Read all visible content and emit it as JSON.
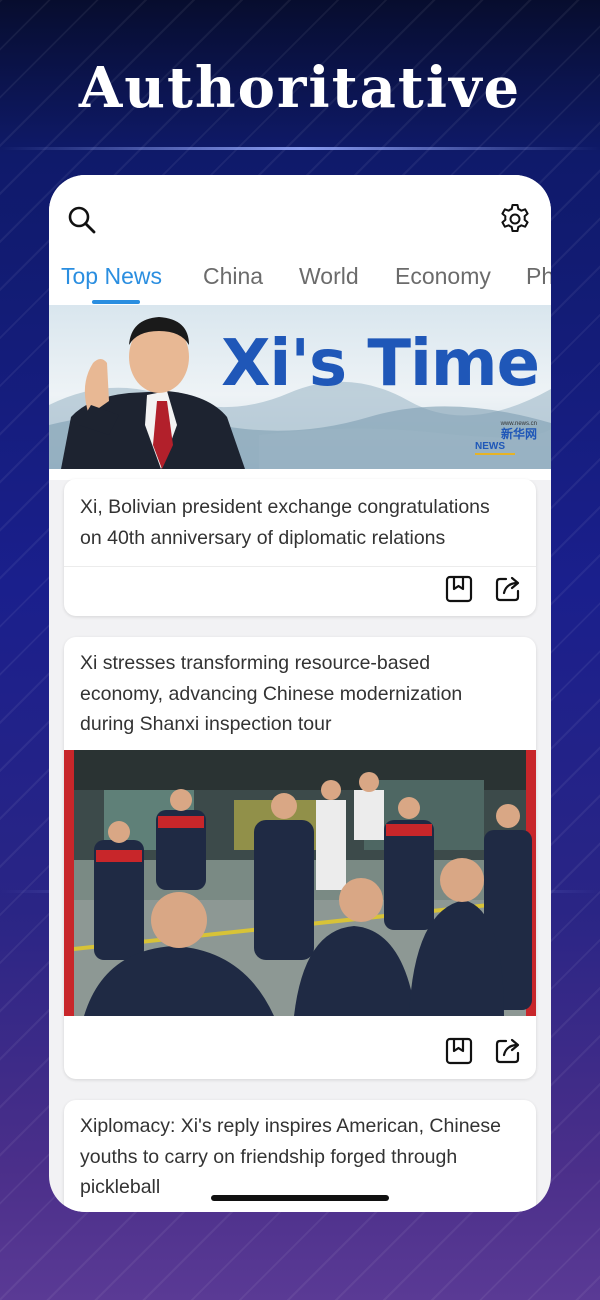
{
  "promo": {
    "headline": "Authoritative"
  },
  "app": {
    "icons": {
      "search": "search-icon",
      "settings": "gear-icon",
      "bookmark": "bookmark-icon",
      "share": "share-icon"
    },
    "colors": {
      "accent": "#2a8ee0",
      "text": "#333333",
      "tab_inactive": "#6b6b6b"
    },
    "tabs": [
      {
        "label": "Top News",
        "active": true
      },
      {
        "label": "China",
        "active": false
      },
      {
        "label": "World",
        "active": false
      },
      {
        "label": "Economy",
        "active": false
      },
      {
        "label": "Ph",
        "active": false
      }
    ],
    "banner": {
      "title": "Xi's Time",
      "logo_url_text": "www.news.cn",
      "logo_cn": "新华网",
      "logo_en": "NEWS"
    },
    "articles": [
      {
        "title": "Xi, Bolivian president exchange congratulations on 40th anniversary of diplomatic relations"
      },
      {
        "title": "Xi stresses transforming resource-based economy, advancing Chinese modernization during Shanxi inspection tour"
      },
      {
        "title": "Xiplomacy: Xi's reply inspires American, Chinese youths to carry on friendship forged through pickleball"
      }
    ]
  }
}
